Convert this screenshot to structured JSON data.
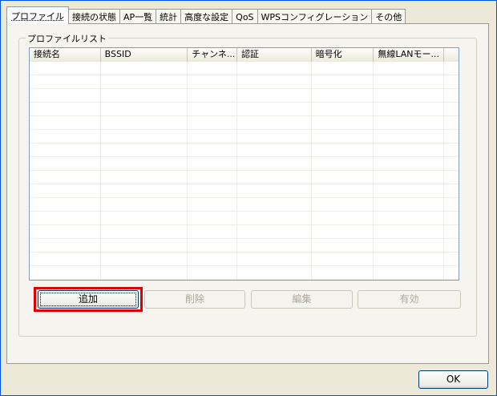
{
  "tabs": [
    {
      "label": "プロファイル",
      "active": true
    },
    {
      "label": "接続の状態",
      "active": false
    },
    {
      "label": "AP一覧",
      "active": false
    },
    {
      "label": "統計",
      "active": false
    },
    {
      "label": "高度な設定",
      "active": false
    },
    {
      "label": "QoS",
      "active": false
    },
    {
      "label": "WPSコンフィグレーション",
      "active": false
    },
    {
      "label": "その他",
      "active": false
    }
  ],
  "profile_list": {
    "title": "プロファイルリスト",
    "columns": [
      "接続名",
      "BSSID",
      "チャンネ...",
      "認証",
      "暗号化",
      "無線LANモー..."
    ],
    "rows": []
  },
  "buttons": {
    "add": "追加",
    "delete": "削除",
    "edit": "編集",
    "enable": "有効",
    "ok": "OK"
  },
  "colors": {
    "highlight": "#e00000",
    "window_border": "#0054e3",
    "background": "#ece9d8"
  }
}
